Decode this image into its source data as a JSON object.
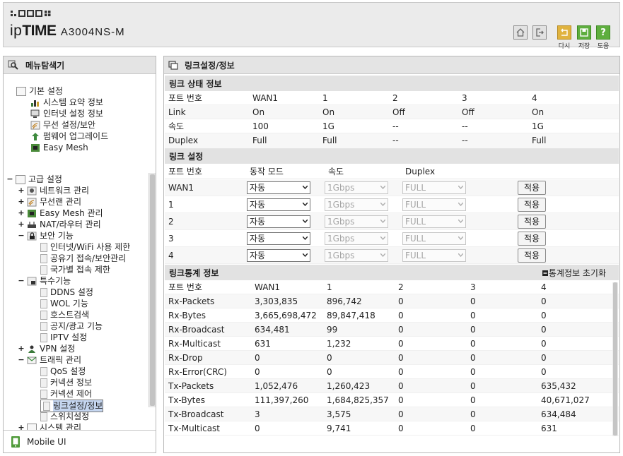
{
  "header": {
    "brand_prefix": "ip",
    "brand_bold": "TIME",
    "model": "A3004NS-M",
    "buttons": [
      {
        "label": "",
        "icon": "home-icon"
      },
      {
        "label": "",
        "icon": "logout-icon"
      },
      {
        "label": "다시",
        "icon": "restart-icon"
      },
      {
        "label": "저장",
        "icon": "save-icon"
      },
      {
        "label": "도움",
        "icon": "help-icon",
        "glyph": "?"
      }
    ]
  },
  "sidebar": {
    "title": "메뉴탐색기",
    "basic": {
      "label": "기본 설정",
      "items": [
        "시스템 요약 정보",
        "인터넷 설정 정보",
        "무선 설정/보안",
        "펌웨어 업그레이드",
        "Easy Mesh"
      ]
    },
    "advanced": {
      "label": "고급 설정",
      "items": [
        {
          "expander": "+",
          "label": "네트워크 관리"
        },
        {
          "expander": "+",
          "label": "무선랜 관리"
        },
        {
          "expander": "+",
          "label": "Easy Mesh 관리"
        },
        {
          "expander": "+",
          "label": "NAT/라우터 관리"
        },
        {
          "expander": "−",
          "label": "보안 기능",
          "children": [
            "인터넷/WiFi 사용 제한",
            "공유기 접속/보안관리",
            "국가별 접속 제한"
          ]
        },
        {
          "expander": "−",
          "label": "특수기능",
          "children": [
            "DDNS 설정",
            "WOL 기능",
            "호스트검색",
            "공지/광고 기능",
            "IPTV 설정"
          ]
        },
        {
          "expander": "+",
          "label": "VPN 설정"
        },
        {
          "expander": "−",
          "label": "트래픽 관리",
          "children": [
            "QoS 설정",
            "커넥션 정보",
            "커넥션 제어",
            "링크설정/정보",
            "스위치설정"
          ]
        },
        {
          "expander": "+",
          "label": "시스템 관리"
        }
      ]
    },
    "mobile_label": "Mobile UI"
  },
  "main": {
    "title": "링크설정/정보",
    "status": {
      "title": "링크 상태 정보",
      "headers": [
        "포트 번호",
        "WAN1",
        "1",
        "2",
        "3",
        "4"
      ],
      "rows": [
        [
          "Link",
          "On",
          "On",
          "Off",
          "Off",
          "On"
        ],
        [
          "속도",
          "100",
          "1G",
          "--",
          "--",
          "1G"
        ],
        [
          "Duplex",
          "Full",
          "Full",
          "--",
          "--",
          "Full"
        ]
      ]
    },
    "settings": {
      "title": "링크 설정",
      "headers": [
        "포트 번호",
        "동작 모드",
        "속도",
        "Duplex"
      ],
      "apply_label": "적용",
      "rows": [
        {
          "port": "WAN1",
          "mode": "자동",
          "speed": "1Gbps",
          "duplex": "FULL"
        },
        {
          "port": "1",
          "mode": "자동",
          "speed": "1Gbps",
          "duplex": "FULL"
        },
        {
          "port": "2",
          "mode": "자동",
          "speed": "1Gbps",
          "duplex": "FULL"
        },
        {
          "port": "3",
          "mode": "자동",
          "speed": "1Gbps",
          "duplex": "FULL"
        },
        {
          "port": "4",
          "mode": "자동",
          "speed": "1Gbps",
          "duplex": "FULL"
        }
      ]
    },
    "stats": {
      "title": "링크통계 정보",
      "reset_label": "통계정보 초기화",
      "headers": [
        "포트 번호",
        "WAN1",
        "1",
        "2",
        "3",
        "4"
      ],
      "rows": [
        [
          "Rx-Packets",
          "3,303,835",
          "896,742",
          "0",
          "0",
          "0"
        ],
        [
          "Rx-Bytes",
          "3,665,698,472",
          "89,847,418",
          "0",
          "0",
          "0"
        ],
        [
          "Rx-Broadcast",
          "634,481",
          "99",
          "0",
          "0",
          "0"
        ],
        [
          "Rx-Multicast",
          "631",
          "1,232",
          "0",
          "0",
          "0"
        ],
        [
          "Rx-Drop",
          "0",
          "0",
          "0",
          "0",
          "0"
        ],
        [
          "Rx-Error(CRC)",
          "0",
          "0",
          "0",
          "0",
          "0"
        ],
        [
          "Tx-Packets",
          "1,052,476",
          "1,260,423",
          "0",
          "0",
          "635,432"
        ],
        [
          "Tx-Bytes",
          "111,397,260",
          "1,684,825,357",
          "0",
          "0",
          "40,671,027"
        ],
        [
          "Tx-Broadcast",
          "3",
          "3,575",
          "0",
          "0",
          "634,484"
        ],
        [
          "Tx-Multicast",
          "0",
          "9,741",
          "0",
          "0",
          "631"
        ]
      ]
    }
  }
}
